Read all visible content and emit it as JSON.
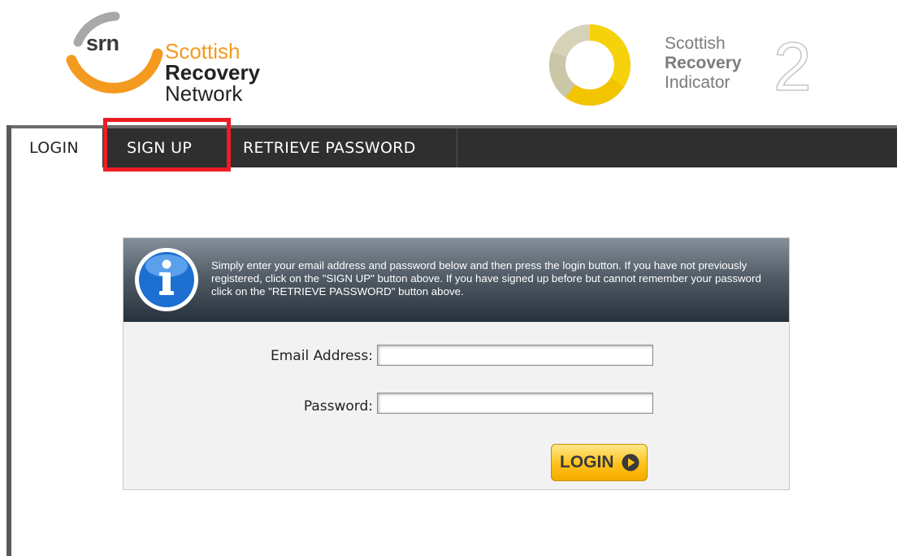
{
  "header": {
    "srn_logo": {
      "abbr": "srn",
      "line1": "Scottish",
      "line2": "Recovery",
      "line3": "Network"
    },
    "sri_logo": {
      "line1": "Scottish",
      "line2": "Recovery",
      "line3": "Indicator",
      "numeral": "2"
    }
  },
  "nav": {
    "tabs": [
      {
        "label": "LOGIN",
        "active": true
      },
      {
        "label": "SIGN UP",
        "active": false,
        "highlighted": true
      },
      {
        "label": "RETRIEVE PASSWORD",
        "active": false
      }
    ]
  },
  "login_panel": {
    "info_icon": "info-icon",
    "info_text": "Simply enter your email address and password below and then press the login button. If you have not previously registered, click on the \"SIGN UP\" button above. If you have signed up before but cannot remember your password click on the \"RETRIEVE PASSWORD\" button above.",
    "email_label": "Email Address:",
    "email_value": "",
    "password_label": "Password:",
    "password_value": "",
    "login_button": "LOGIN"
  },
  "colors": {
    "srn_orange": "#f39a1f",
    "sri_yellow": "#f5d20a",
    "nav_dark": "#2f2f2f",
    "highlight_red": "#ee1c24",
    "button_gold": "#ffc21a"
  }
}
